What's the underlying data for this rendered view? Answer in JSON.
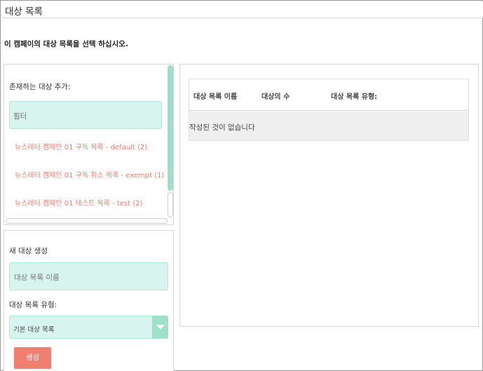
{
  "window": {
    "title": "대상 목록"
  },
  "instruction": "이 캠페이의 대상 목록을 선택 하십시오.",
  "existing": {
    "heading": "존재하는 대상 추가:",
    "filter_placeholder": "필터",
    "items": [
      {
        "label": "뉴스레터 캠페인 01 구독 목록 - default (2)"
      },
      {
        "label": "뉴스레터 캠페인 01 구독 취소 목록 - exempt (1)"
      },
      {
        "label": "뉴스레터 캠페인 01 테스트 목록 - test (2)"
      }
    ]
  },
  "create": {
    "heading": "새 대상 생성",
    "name_placeholder": "대상 목록 이름",
    "type_label": "대상 목록 유형:",
    "type_value": "기본 대상 목록",
    "button_label": "생성"
  },
  "table": {
    "headers": [
      "대상 목록 이름",
      "대상의 수",
      "대상 목록 유형:"
    ],
    "empty_text": "작성된 것이 없습니다"
  },
  "colors": {
    "accent_mint": "#d7f5ee",
    "scroll_thumb": "#a1ddca",
    "link": "#ef7f6f",
    "button": "#f07f72"
  }
}
